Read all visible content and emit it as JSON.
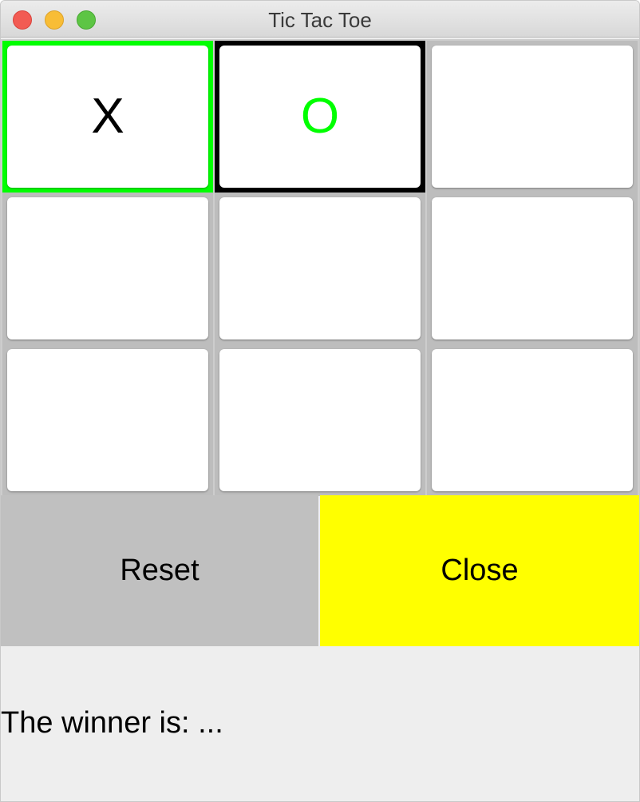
{
  "window": {
    "title": "Tic Tac Toe"
  },
  "board": {
    "cells": [
      {
        "mark": "X",
        "mark_color": "#000000",
        "border_color": "#00ff00"
      },
      {
        "mark": "O",
        "mark_color": "#00ff00",
        "border_color": "#000000"
      },
      {
        "mark": "",
        "mark_color": "#000000",
        "border_color": ""
      },
      {
        "mark": "",
        "mark_color": "#000000",
        "border_color": ""
      },
      {
        "mark": "",
        "mark_color": "#000000",
        "border_color": ""
      },
      {
        "mark": "",
        "mark_color": "#000000",
        "border_color": ""
      },
      {
        "mark": "",
        "mark_color": "#000000",
        "border_color": ""
      },
      {
        "mark": "",
        "mark_color": "#000000",
        "border_color": ""
      },
      {
        "mark": "",
        "mark_color": "#000000",
        "border_color": ""
      }
    ]
  },
  "buttons": {
    "reset_label": "Reset",
    "reset_color": "#c0c0c0",
    "close_label": "Close",
    "close_color": "#ffff00"
  },
  "status": {
    "text": "The winner is: ..."
  }
}
